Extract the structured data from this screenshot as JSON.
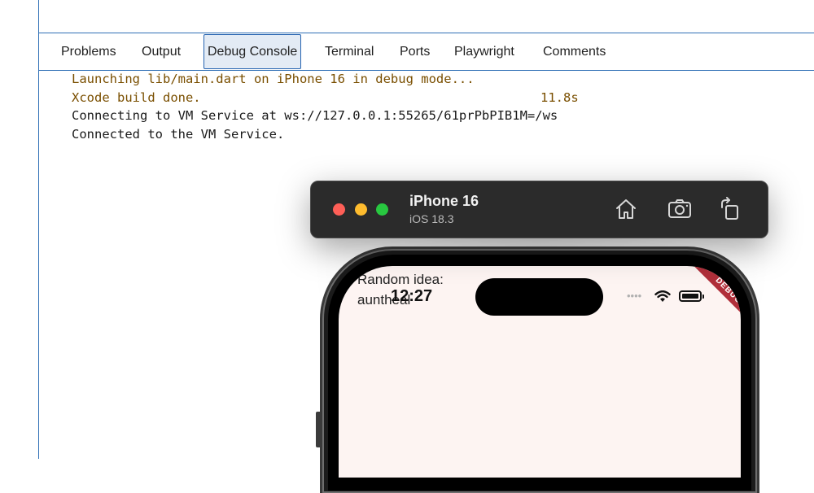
{
  "panel": {
    "tabs": [
      {
        "label": "Problems"
      },
      {
        "label": "Output"
      },
      {
        "label": "Debug Console",
        "active": true
      },
      {
        "label": "Terminal"
      },
      {
        "label": "Ports"
      },
      {
        "label": "Playwright"
      },
      {
        "label": "Comments"
      }
    ]
  },
  "console": {
    "lines": [
      {
        "text": "Launching lib/main.dart on iPhone 16 in debug mode..."
      },
      {
        "text": "Xcode build done.",
        "time": "11.8s"
      },
      {
        "text": "Connecting to VM Service at ws://127.0.0.1:55265/61prPbPIB1M=/ws"
      },
      {
        "text": "Connected to the VM Service."
      }
    ]
  },
  "simulator": {
    "device_name": "iPhone 16",
    "os_version": "iOS 18.3",
    "toolbar_icons": [
      "home-icon",
      "screenshot-icon",
      "rotate-icon"
    ]
  },
  "app": {
    "label_line1": "Random idea:",
    "label_line2": "auntheal",
    "status_time": "12:27",
    "debug_banner": "DEBUG"
  }
}
